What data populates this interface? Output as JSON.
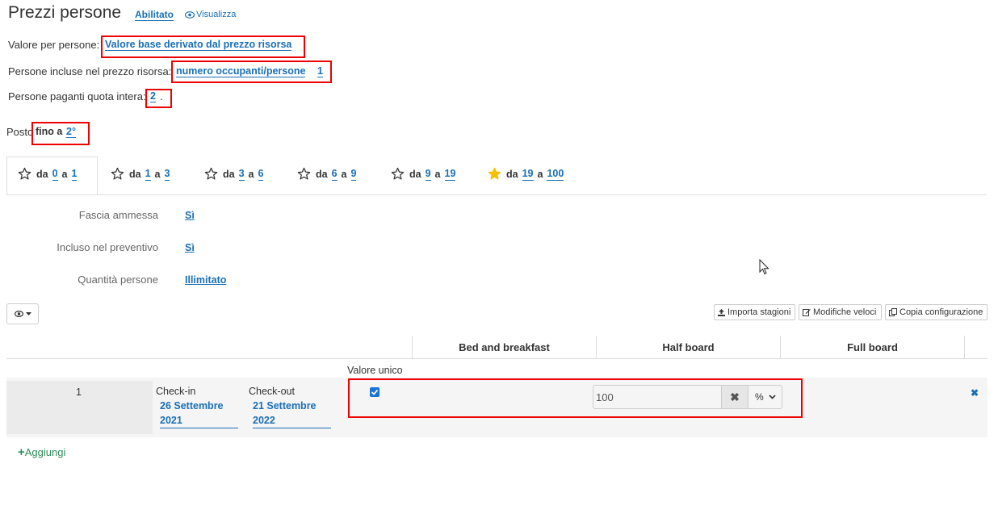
{
  "header": {
    "title": "Prezzi persone",
    "status": "Abilitato",
    "view_label": "Visualizza"
  },
  "settings": {
    "valore_label": "Valore per persone:",
    "valore_value": "Valore base derivato dal prezzo risorsa",
    "incluse_label": "Persone incluse nel prezzo risorsa:",
    "incluse_value": "numero occupanti/persone",
    "incluse_num": "1",
    "paganti_label": "Persone paganti quota intera:",
    "paganti_value": "2",
    "paganti_suffix": ".",
    "posto_label": "Posto",
    "posto_prefix": "fino a",
    "posto_value": "2°"
  },
  "tabs": [
    {
      "from": "0",
      "to": "1",
      "starred": false
    },
    {
      "from": "1",
      "to": "3",
      "starred": false
    },
    {
      "from": "3",
      "to": "6",
      "starred": false
    },
    {
      "from": "6",
      "to": "9",
      "starred": false
    },
    {
      "from": "9",
      "to": "19",
      "starred": false
    },
    {
      "from": "19",
      "to": "100",
      "starred": true
    }
  ],
  "tab_words": {
    "da": "da",
    "a": "a"
  },
  "props": {
    "fascia_label": "Fascia ammessa",
    "fascia_value": "Sì",
    "incluso_label": "Incluso nel preventivo",
    "incluso_value": "Sì",
    "quantita_label": "Quantità persone",
    "quantita_value": "Illimitato"
  },
  "toolbar": {
    "eye_icon": "eye-icon",
    "importa": "Importa stagioni",
    "modifiche": "Modifiche veloci",
    "copia": "Copia configurazione"
  },
  "table": {
    "columns": [
      "Bed and breakfast",
      "Half board",
      "Full board"
    ],
    "valore_unico": "Valore unico",
    "row": {
      "index": "1",
      "checkin_label": "Check-in",
      "checkin_date_1": "26 Settembre",
      "checkin_date_2": "2021",
      "checkout_label": "Check-out",
      "checkout_date_1": "21 Settembre",
      "checkout_date_2": "2022",
      "value": "100",
      "unit": "%",
      "checked": true
    }
  },
  "add_label": "Aggiungi",
  "colors": {
    "link": "#1a6fb5",
    "highlight": "#e00000",
    "star_active": "#f5c000",
    "add": "#2e8b57"
  }
}
